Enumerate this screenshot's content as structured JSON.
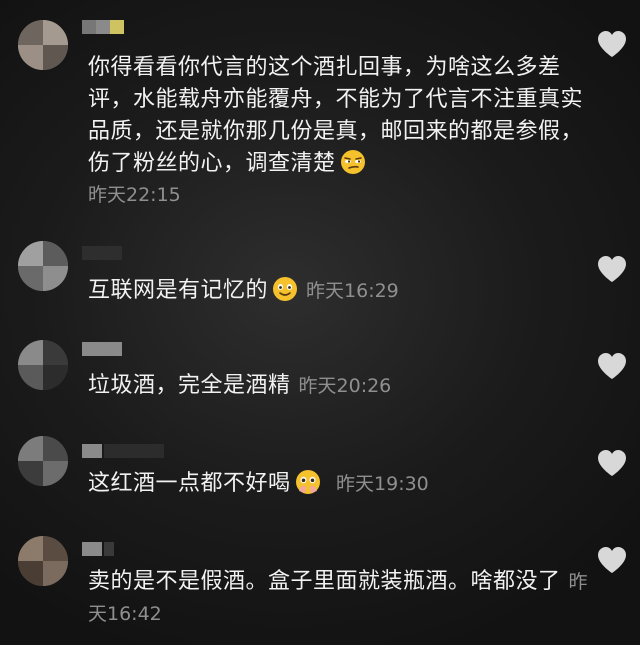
{
  "colors": {
    "background": "#1b1b1b",
    "text": "#f2f2f2",
    "timestamp": "#8f8f8f",
    "heart": "#d8d8d8",
    "emoji": "#f5c12c"
  },
  "comments": [
    {
      "text": "你得看看你代言的这个酒扎回事，为啥这么多差评，水能载舟亦能覆舟，不能为了代言不注重真实品质，还是就你那几份是真，邮回来的都是参假，伤了粉丝的心，调查清楚",
      "emoji": "smirking-face-emoji",
      "timestamp": "昨天22:15"
    },
    {
      "text": "互联网是有记忆的",
      "emoji": "smiling-face-emoji",
      "timestamp": "昨天16:29"
    },
    {
      "text": "垃圾酒，完全是酒精",
      "timestamp": "昨天20:26"
    },
    {
      "text": "这红酒一点都不好喝",
      "emoji": "pleading-face-emoji",
      "timestamp": "昨天19:30"
    },
    {
      "text": "卖的是不是假酒。盒子里面就装瓶酒。啥都没了",
      "timestamp": "昨天16:42"
    }
  ]
}
